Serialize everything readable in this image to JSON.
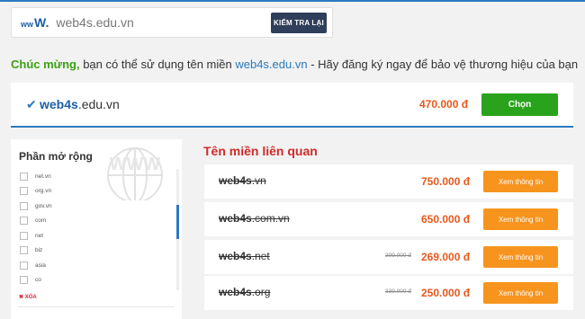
{
  "colors": {
    "accent": "#2a7bc0",
    "green": "#2aa31c",
    "orange": "#f7941d",
    "price": "#e8581c",
    "heading": "#d12b2b"
  },
  "search": {
    "logo_small": "ww",
    "logo_big": "W.",
    "value": "web4s.edu.vn",
    "button_label": "KIỂM TRA LẠI"
  },
  "congrats": {
    "lead": "Chúc mừng,",
    "text1": " bạn có thể sử dụng tên miền ",
    "domain": "web4s.edu.vn",
    "text2": " - Hãy đăng ký ngay để bảo vệ thương hiệu của bạn"
  },
  "main_result": {
    "name_bold": "web4s",
    "name_tld": ".edu.vn",
    "price": "470.000 đ",
    "button_label": "Chọn"
  },
  "sidebar": {
    "title": "Phần mở rộng",
    "extensions": [
      "net.vn",
      "org.vn",
      "gov.vn",
      "com",
      "net",
      "biz",
      "asia",
      "co"
    ],
    "clear_label": "✖ XÓA"
  },
  "related": {
    "title": "Tên miền liên quan",
    "button_label": "Xem thông tin",
    "rows": [
      {
        "name_bold": "web4s",
        "tld": ".vn",
        "old_price": "",
        "price": "750.000 đ"
      },
      {
        "name_bold": "web4s",
        "tld": ".com.vn",
        "old_price": "",
        "price": "650.000 đ"
      },
      {
        "name_bold": "web4s",
        "tld": ".net",
        "old_price": "309.000 đ",
        "price": "269.000 đ"
      },
      {
        "name_bold": "web4s",
        "tld": ".org",
        "old_price": "339.000 đ",
        "price": "250.000 đ"
      }
    ]
  }
}
